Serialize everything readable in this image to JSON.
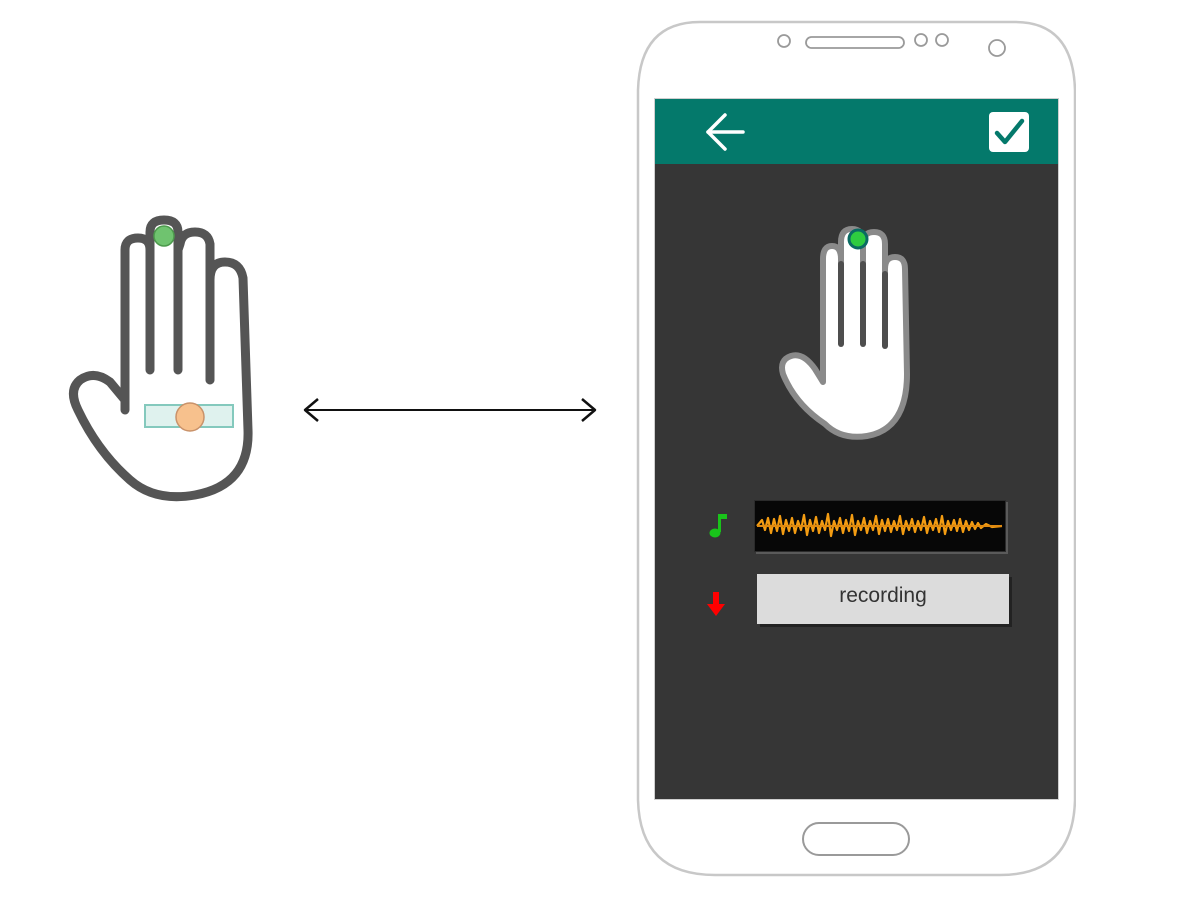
{
  "colors": {
    "app_bar": "#04796b",
    "screen_background": "#363636",
    "fingertip_marker": "#2ecc40",
    "wrist_sensor": "#f7c18d",
    "wrist_band": "#dff2ee",
    "hand_outline": "#555555",
    "waveform": "#f39c12",
    "note_icon": "#19c31a",
    "down_arrow_icon": "#ff0000"
  },
  "icons": {
    "back": "arrow-left-icon",
    "confirm": "checkbox-checked-icon",
    "audio": "music-note-icon",
    "record": "arrow-down-icon",
    "connection": "double-arrow-icon"
  },
  "recording_button": {
    "label": "recording"
  }
}
